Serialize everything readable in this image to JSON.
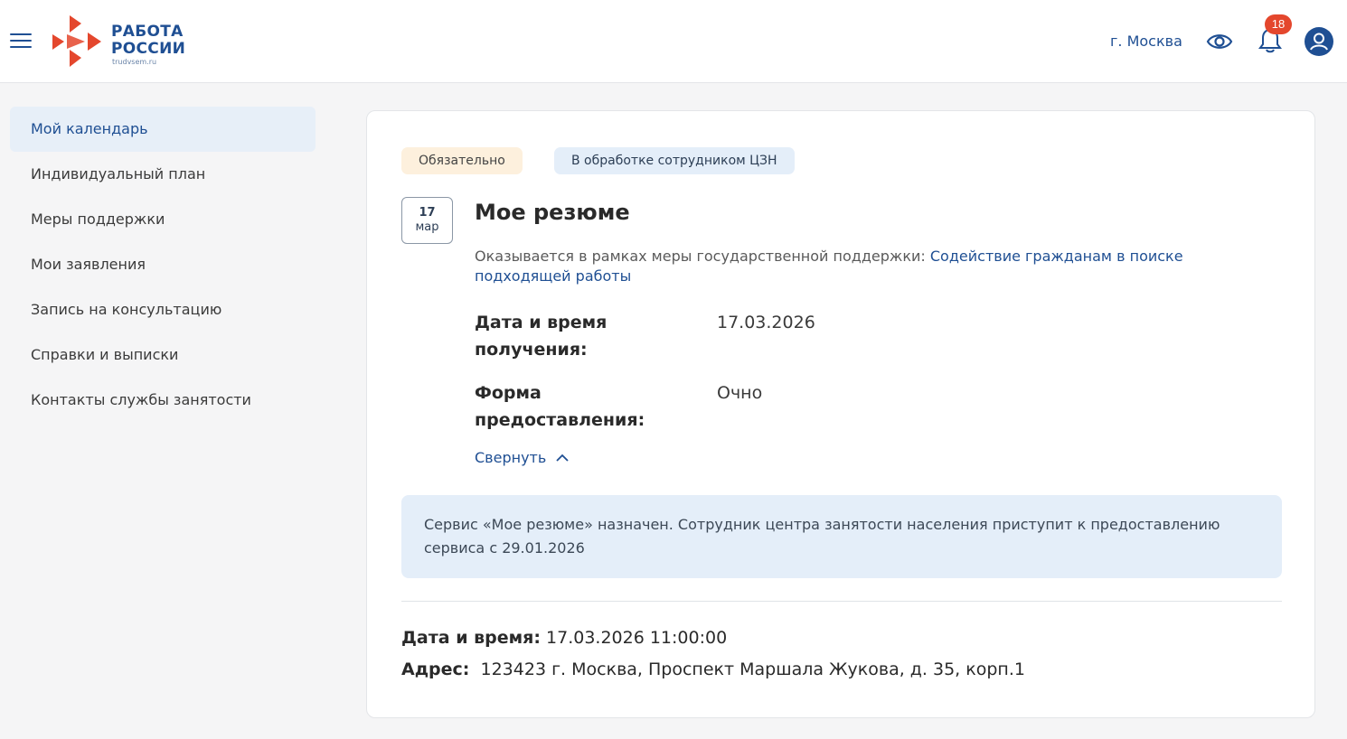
{
  "header": {
    "logo_line1": "РАБОТА",
    "logo_line2": "РОССИИ",
    "logo_sub": "trudvsem.ru",
    "city": "г. Москва",
    "notifications_count": "18"
  },
  "sidebar": {
    "items": [
      {
        "label": "Мой календарь",
        "active": true
      },
      {
        "label": "Индивидуальный план"
      },
      {
        "label": "Меры поддержки"
      },
      {
        "label": "Мои заявления"
      },
      {
        "label": "Запись на консультацию"
      },
      {
        "label": "Справки и выписки"
      },
      {
        "label": "Контакты службы занятости"
      }
    ]
  },
  "card": {
    "chip_required": "Обязательно",
    "chip_status": "В обработке сотрудником ЦЗН",
    "date_day": "17",
    "date_month": "мар",
    "title": "Мое резюме",
    "measure_prefix": "Оказывается в рамках меры государственной поддержки:",
    "measure_link": "Содействие гражданам в поиске подходящей работы",
    "receipt_label": "Дата и время получения:",
    "receipt_value": "17.03.2026",
    "form_label": "Форма предоставления:",
    "form_value": "Очно",
    "collapse_label": "Свернуть",
    "notice": "Сервис «Мое резюме» назначен. Сотрудник центра занятости населения приступит к предоставлению сервиса с 29.01.2026",
    "datetime_label": "Дата и время:",
    "datetime_value": "17.03.2026 11:00:00",
    "address_label": "Адрес:",
    "address_value": "123423 г. Москва, Проспект Маршала Жукова, д. 35, корп.1"
  },
  "colors": {
    "brand_blue": "#1f4f93",
    "logo_red": "#e4472d",
    "active_bg": "#e7eff8",
    "chip_required_bg": "#fdf0dd",
    "chip_status_bg": "#e4eef9"
  }
}
